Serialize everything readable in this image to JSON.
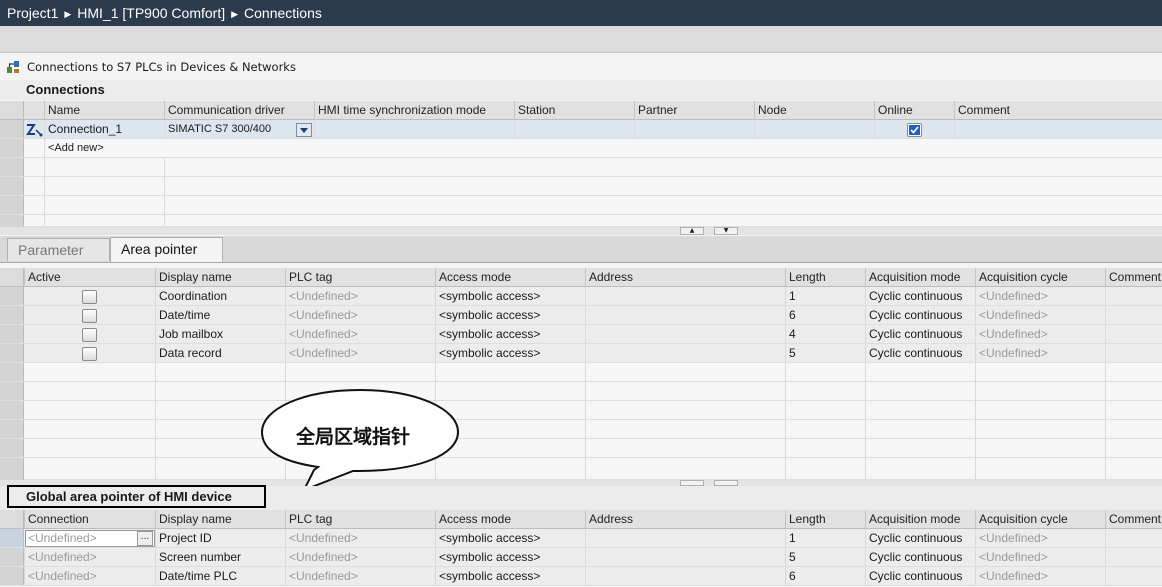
{
  "breadcrumb": [
    "Project1",
    "HMI_1 [TP900 Comfort]",
    "Connections"
  ],
  "s7_link": "Connections to S7 PLCs in Devices & Networks",
  "connections": {
    "title": "Connections",
    "columns": [
      "Name",
      "Communication driver",
      "HMI time synchronization mode",
      "Station",
      "Partner",
      "Node",
      "Online",
      "Comment"
    ],
    "rows": [
      {
        "name": "Connection_1",
        "driver": "SIMATIC S7 300/400",
        "online": true
      }
    ],
    "add_new": "<Add new>"
  },
  "tabs": [
    "Parameter",
    "Area pointer"
  ],
  "area_pointer": {
    "columns": [
      "Active",
      "Display name",
      "PLC tag",
      "Access mode",
      "Address",
      "Length",
      "Acquisition mode",
      "Acquisition cycle",
      "Comment"
    ],
    "rows": [
      {
        "display": "Coordination",
        "plc_tag": "<Undefined>",
        "access": "<symbolic access>",
        "length": "1",
        "acq_mode": "Cyclic continuous",
        "acq_cycle": "<Undefined>"
      },
      {
        "display": "Date/time",
        "plc_tag": "<Undefined>",
        "access": "<symbolic access>",
        "length": "6",
        "acq_mode": "Cyclic continuous",
        "acq_cycle": "<Undefined>"
      },
      {
        "display": "Job mailbox",
        "plc_tag": "<Undefined>",
        "access": "<symbolic access>",
        "length": "4",
        "acq_mode": "Cyclic continuous",
        "acq_cycle": "<Undefined>"
      },
      {
        "display": "Data record",
        "plc_tag": "<Undefined>",
        "access": "<symbolic access>",
        "length": "5",
        "acq_mode": "Cyclic continuous",
        "acq_cycle": "<Undefined>"
      }
    ]
  },
  "callout": "全局区域指针",
  "global_area": {
    "title": "Global area pointer of HMI device",
    "columns": [
      "Connection",
      "Display name",
      "PLC tag",
      "Access mode",
      "Address",
      "Length",
      "Acquisition mode",
      "Acquisition cycle",
      "Comment"
    ],
    "rows": [
      {
        "connection": "<Undefined>",
        "display": "Project ID",
        "plc_tag": "<Undefined>",
        "access": "<symbolic access>",
        "length": "1",
        "acq_mode": "Cyclic continuous",
        "acq_cycle": "<Undefined>"
      },
      {
        "connection": "<Undefined>",
        "display": "Screen number",
        "plc_tag": "<Undefined>",
        "access": "<symbolic access>",
        "length": "5",
        "acq_mode": "Cyclic continuous",
        "acq_cycle": "<Undefined>"
      },
      {
        "connection": "<Undefined>",
        "display": "Date/time PLC",
        "plc_tag": "<Undefined>",
        "access": "<symbolic access>",
        "length": "6",
        "acq_mode": "Cyclic continuous",
        "acq_cycle": "<Undefined>"
      }
    ]
  },
  "colors": {
    "titlebar": "#2b3a4d",
    "checkbox_blue": "#1f5fbf"
  }
}
